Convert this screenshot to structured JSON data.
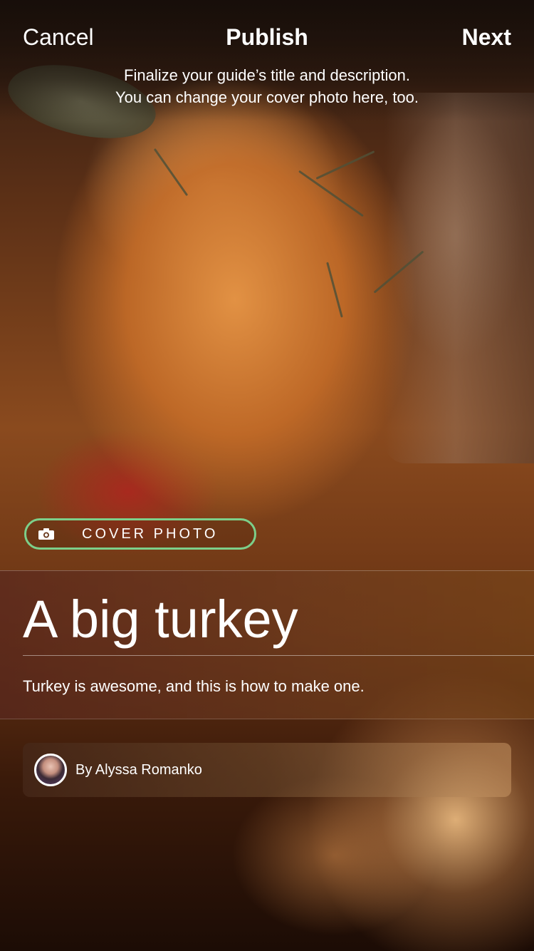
{
  "header": {
    "cancel_label": "Cancel",
    "title": "Publish",
    "next_label": "Next",
    "subtitle_line1": "Finalize your guide’s title and description.",
    "subtitle_line2": "You can change your cover photo here, too."
  },
  "cover_photo": {
    "label": "COVER PHOTO",
    "icon": "camera-icon",
    "border_color": "#7ccf8a"
  },
  "guide": {
    "title": "A big turkey",
    "description": "Turkey is awesome, and this is how to make one."
  },
  "author": {
    "byline": "By Alyssa Romanko",
    "avatar": "avatar-image"
  }
}
